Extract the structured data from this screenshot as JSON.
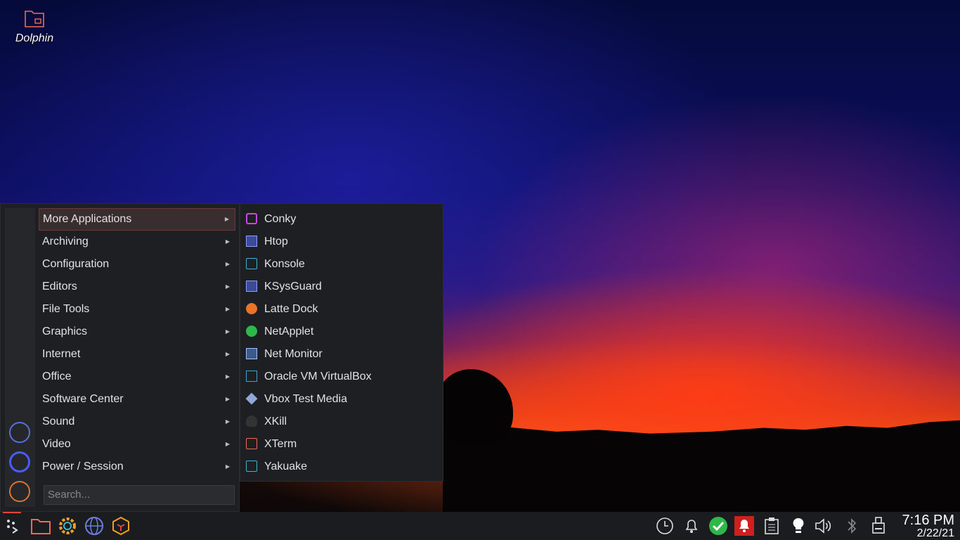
{
  "desktop": {
    "icon_label": "Dolphin"
  },
  "menu": {
    "categories": [
      {
        "label": "More Applications"
      },
      {
        "label": "Archiving"
      },
      {
        "label": "Configuration"
      },
      {
        "label": "Editors"
      },
      {
        "label": "File Tools"
      },
      {
        "label": "Graphics"
      },
      {
        "label": "Internet"
      },
      {
        "label": "Office"
      },
      {
        "label": "Software Center"
      },
      {
        "label": "Sound"
      },
      {
        "label": "Video"
      },
      {
        "label": "Power / Session"
      }
    ],
    "search_placeholder": "Search..."
  },
  "submenu": {
    "items": [
      {
        "label": "Conky"
      },
      {
        "label": "Htop"
      },
      {
        "label": "Konsole"
      },
      {
        "label": "KSysGuard"
      },
      {
        "label": "Latte Dock"
      },
      {
        "label": "NetApplet"
      },
      {
        "label": "Net Monitor"
      },
      {
        "label": "Oracle VM VirtualBox"
      },
      {
        "label": "Vbox Test Media"
      },
      {
        "label": "XKill"
      },
      {
        "label": "XTerm"
      },
      {
        "label": "Yakuake"
      }
    ]
  },
  "clock": {
    "time": "7:16 PM",
    "date": "2/22/21"
  },
  "colors": {
    "accent": "#e0443b",
    "menu_bg": "#1d1f22",
    "active_bg": "#3a2d2f"
  }
}
